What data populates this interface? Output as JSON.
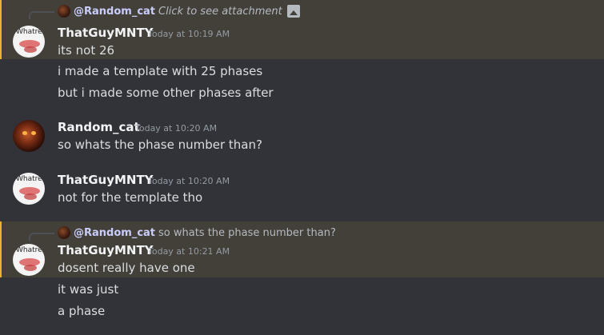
{
  "messages": [
    {
      "reply": {
        "author": "@Random_cat",
        "text": "Click to see attachment",
        "has_image_icon": true
      },
      "author": "ThatGuyMNTY",
      "time": "Today at 10:19 AM",
      "avatar": "whatr-avatar",
      "avatar_text": "Whatre",
      "lines": [
        "its not 26",
        "i made a template with 25 phases",
        "but i made some other phases after"
      ]
    },
    {
      "author": "Random_cat",
      "time": "Today at 10:20 AM",
      "avatar": "cat-avatar",
      "lines": [
        "so whats the phase number than?"
      ]
    },
    {
      "author": "ThatGuyMNTY",
      "time": "Today at 10:20 AM",
      "avatar": "whatr-avatar",
      "avatar_text": "Whatre",
      "lines": [
        "not for the template tho"
      ]
    },
    {
      "reply": {
        "author": "@Random_cat",
        "text": "so whats the phase number than?"
      },
      "author": "ThatGuyMNTY",
      "time": "Today at 10:21 AM",
      "avatar": "whatr-avatar",
      "avatar_text": "Whatre",
      "lines": [
        "dosent really have one",
        "it was just",
        "a phase"
      ]
    }
  ],
  "colors": {
    "background": "#313338",
    "highlight": "#43403a",
    "mention_bar": "#f0b232"
  }
}
